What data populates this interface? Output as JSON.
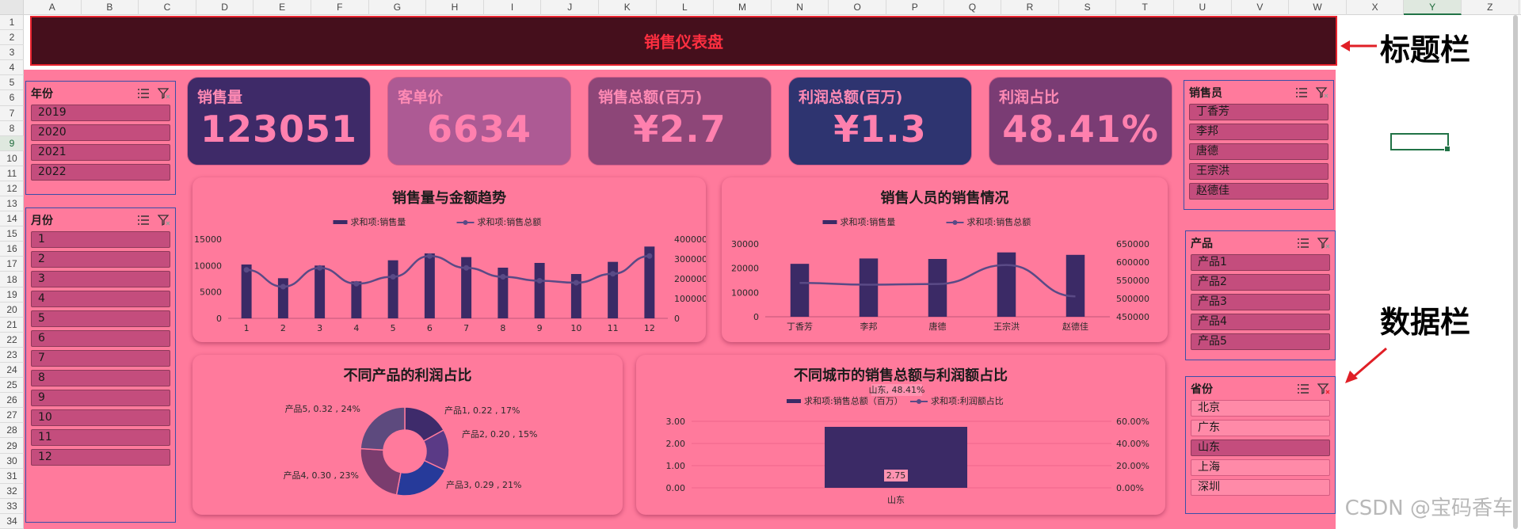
{
  "sheet": {
    "columns": [
      "A",
      "B",
      "C",
      "D",
      "E",
      "F",
      "G",
      "H",
      "I",
      "J",
      "K",
      "L",
      "M",
      "N",
      "O",
      "P",
      "Q",
      "R",
      "S",
      "T",
      "U",
      "V",
      "W",
      "X",
      "Y",
      "Z"
    ],
    "rows": [
      "1",
      "2",
      "3",
      "4",
      "5",
      "6",
      "7",
      "8",
      "9",
      "10",
      "11",
      "12",
      "13",
      "14",
      "15",
      "16",
      "17",
      "18",
      "19",
      "20",
      "21",
      "22",
      "23",
      "24",
      "25",
      "26",
      "27",
      "28",
      "29",
      "30",
      "31",
      "32",
      "33",
      "34"
    ],
    "selected_column": "Y",
    "selected_row": "9"
  },
  "dashboard": {
    "title": "销售仪表盘"
  },
  "slicers": {
    "year": {
      "title": "年份",
      "items": [
        "2019",
        "2020",
        "2021",
        "2022"
      ]
    },
    "month": {
      "title": "月份",
      "items": [
        "1",
        "2",
        "3",
        "4",
        "5",
        "6",
        "7",
        "8",
        "9",
        "10",
        "11",
        "12"
      ]
    },
    "salesperson": {
      "title": "销售员",
      "items": [
        "丁香芳",
        "李邦",
        "唐德",
        "王宗洪",
        "赵德佳"
      ]
    },
    "product": {
      "title": "产品",
      "items": [
        "产品1",
        "产品2",
        "产品3",
        "产品4",
        "产品5"
      ]
    },
    "province": {
      "title": "省份",
      "items": [
        "北京",
        "广东",
        "山东",
        "上海",
        "深圳"
      ],
      "selected": "山东"
    }
  },
  "kpis": [
    {
      "label": "销售量",
      "value": "123051",
      "bg": "#3e2a68"
    },
    {
      "label": "客单价",
      "value": "6634",
      "bg": "#ad5a94"
    },
    {
      "label": "销售总额(百万)",
      "value": "¥2.7",
      "bg": "#8d4678"
    },
    {
      "label": "利润总额(百万)",
      "value": "¥1.3",
      "bg": "#2e3470"
    },
    {
      "label": "利润占比",
      "value": "48.41%",
      "bg": "#7a3c74"
    }
  ],
  "chart_data": [
    {
      "type": "bar",
      "title": "销售量与金额趋势",
      "categories": [
        "1",
        "2",
        "3",
        "4",
        "5",
        "6",
        "7",
        "8",
        "9",
        "10",
        "11",
        "12"
      ],
      "series": [
        {
          "name": "求和项:销售量",
          "kind": "bar",
          "axis": "left",
          "values": [
            10200,
            7600,
            10000,
            7000,
            11000,
            12300,
            11600,
            9600,
            10500,
            8400,
            10700,
            13600
          ]
        },
        {
          "name": "求和项:销售总额",
          "kind": "line",
          "axis": "right",
          "values": [
            245000,
            160000,
            255000,
            175000,
            210000,
            315000,
            255000,
            210000,
            190000,
            180000,
            225000,
            315000
          ]
        }
      ],
      "left_ticks": [
        "0",
        "5000",
        "10000",
        "15000"
      ],
      "right_ticks": [
        "0",
        "100000",
        "200000",
        "300000",
        "400000"
      ],
      "ylim_left": [
        0,
        15000
      ],
      "ylim_right": [
        0,
        400000
      ]
    },
    {
      "type": "bar",
      "title": "销售人员的销售情况",
      "categories": [
        "丁香芳",
        "李邦",
        "唐德",
        "王宗洪",
        "赵德佳"
      ],
      "series": [
        {
          "name": "求和项:销售量",
          "kind": "bar",
          "axis": "left",
          "values": [
            21800,
            24000,
            23800,
            26500,
            25500
          ]
        },
        {
          "name": "求和项:销售总额",
          "kind": "line",
          "axis": "right",
          "values": [
            543000,
            538000,
            540000,
            592000,
            506000
          ]
        }
      ],
      "left_ticks": [
        "0",
        "10000",
        "20000",
        "30000"
      ],
      "right_ticks": [
        "450000",
        "500000",
        "550000",
        "600000",
        "650000"
      ],
      "ylim_left": [
        0,
        30000
      ],
      "ylim_right": [
        450000,
        650000
      ]
    },
    {
      "type": "pie",
      "title": "不同产品的利润占比",
      "slices": [
        {
          "label": "产品1, 0.22 , 17%",
          "value": 17,
          "color": "#3e2b6b"
        },
        {
          "label": "产品2, 0.20 , 15%",
          "value": 15,
          "color": "#5a3a86"
        },
        {
          "label": "产品3, 0.29 , 21%",
          "value": 21,
          "color": "#263a9a"
        },
        {
          "label": "产品4, 0.30 , 23%",
          "value": 23,
          "color": "#7a3c6e"
        },
        {
          "label": "产品5, 0.32 , 24%",
          "value": 24,
          "color": "#5d4a7e"
        }
      ]
    },
    {
      "type": "bar",
      "title": "不同城市的销售总额与利润额占比",
      "categories": [
        "山东"
      ],
      "series": [
        {
          "name": "求和项:销售总额（百万）",
          "kind": "bar",
          "axis": "left",
          "values": [
            2.75
          ]
        },
        {
          "name": "求和项:利润额占比",
          "kind": "line",
          "axis": "right",
          "values": [
            48.41
          ]
        }
      ],
      "bar_label": "2.75",
      "line_label": "山东, 48.41%",
      "left_ticks": [
        "0.00",
        "1.00",
        "2.00",
        "3.00"
      ],
      "right_ticks": [
        "0.00%",
        "20.00%",
        "40.00%",
        "60.00%"
      ],
      "ylim_left": [
        0,
        3
      ],
      "ylim_right": [
        0,
        60
      ]
    }
  ],
  "annotations": {
    "title_label": "标题栏",
    "data_label": "数据栏"
  },
  "watermark": "CSDN @宝码香车",
  "colors": {
    "bar": "#3b2a66",
    "line": "#5a4a86",
    "title_bg": "#450f1c",
    "title_text": "#ff2f40",
    "panel": "#ff7a9c"
  }
}
